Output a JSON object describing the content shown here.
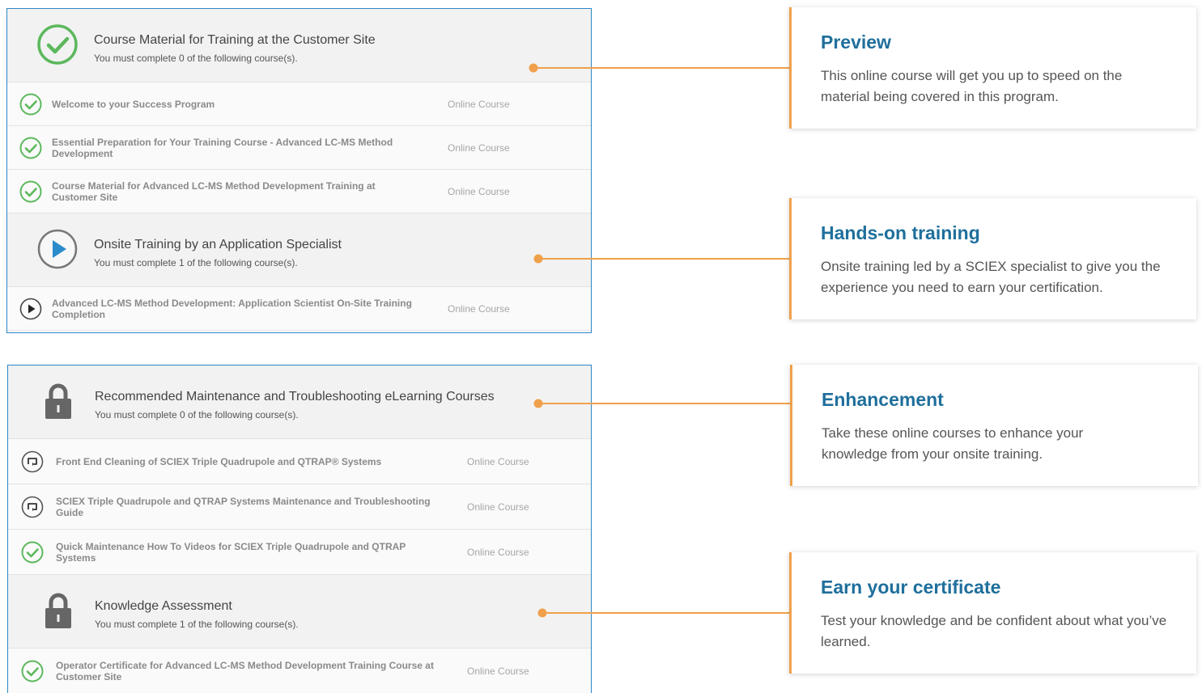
{
  "groups": [
    {
      "title": "Course Material for Training at the Customer Site",
      "subtitle": "You must complete 0 of the following course(s).",
      "icon": "check-circle-icon",
      "items": [
        {
          "title": "Welcome to your Success Program",
          "type": "Online Course",
          "icon": "check-circle-icon"
        },
        {
          "title": "Essential Preparation for Your Training Course - Advanced LC-MS Method Development",
          "type": "Online Course",
          "icon": "check-circle-icon"
        },
        {
          "title": "Course Material for Advanced LC-MS Method Development Training at Customer Site",
          "type": "Online Course",
          "icon": "check-circle-icon"
        }
      ]
    },
    {
      "title": "Onsite Training by an Application Specialist",
      "subtitle": "You must complete 1 of the following course(s).",
      "icon": "play-circle-icon",
      "items": [
        {
          "title": "Advanced LC-MS Method Development: Application Scientist On-Site Training Completion",
          "type": "Online Course",
          "icon": "play-circle-icon"
        }
      ]
    },
    {
      "title": "Recommended Maintenance and Troubleshooting eLearning Courses",
      "subtitle": "You must complete 0 of the following course(s).",
      "icon": "lock-icon",
      "items": [
        {
          "title": "Front End Cleaning of SCIEX Triple Quadrupole and QTRAP® Systems",
          "type": "Online Course",
          "icon": "replay-circle-icon"
        },
        {
          "title": "SCIEX Triple Quadrupole and QTRAP Systems Maintenance and Troubleshooting Guide",
          "type": "Online Course",
          "icon": "replay-circle-icon"
        },
        {
          "title": "Quick Maintenance How To Videos for SCIEX Triple Quadrupole and QTRAP Systems",
          "type": "Online Course",
          "icon": "check-circle-icon"
        }
      ]
    },
    {
      "title": "Knowledge Assessment",
      "subtitle": "You must complete 1 of the following course(s).",
      "icon": "lock-icon",
      "items": [
        {
          "title": "Operator Certificate for Advanced LC-MS Method Development Training Course at Customer Site",
          "type": "Online Course",
          "icon": "check-circle-icon"
        }
      ]
    }
  ],
  "callouts": [
    {
      "title": "Preview",
      "description": "This online course will get you up to speed on the material being covered in this program."
    },
    {
      "title": "Hands-on training",
      "description": "Onsite training led by a SCIEX specialist to give you the experience you need to earn your certification."
    },
    {
      "title": "Enhancement",
      "description": "Take these online courses to enhance your knowledge from your onsite training."
    },
    {
      "title": "Earn your certificate",
      "description": "Test your knowledge and be confident about what you’ve learned."
    }
  ],
  "colors": {
    "panel_border": "#2b86c5",
    "check_green": "#5cb85c",
    "play_blue": "#2a8ccb",
    "callout_orange": "#f0a04b",
    "callout_title": "#1f6f9c"
  }
}
